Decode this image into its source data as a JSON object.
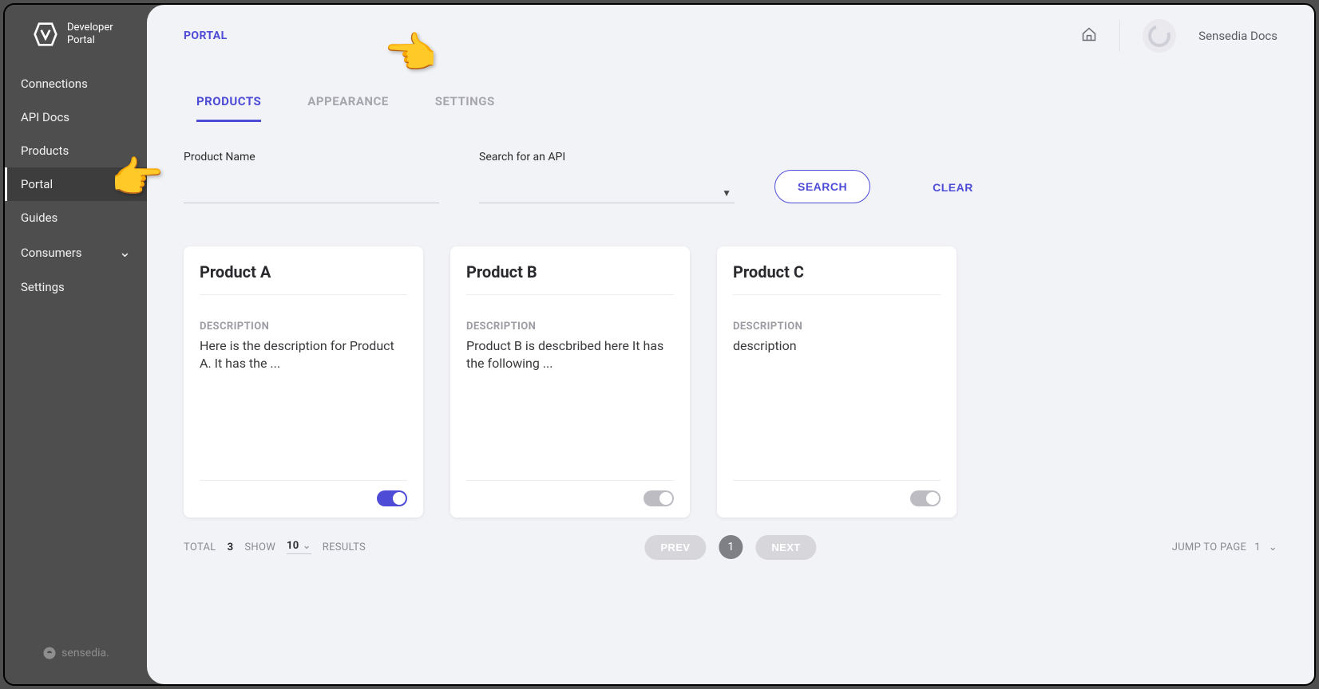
{
  "sidebar": {
    "logo_line1": "Developer",
    "logo_line2": "Portal",
    "items": [
      {
        "label": "Connections"
      },
      {
        "label": "API Docs"
      },
      {
        "label": "Products"
      },
      {
        "label": "Portal",
        "active": true
      },
      {
        "label": "Guides"
      },
      {
        "label": "Consumers",
        "expandable": true
      },
      {
        "label": "Settings"
      }
    ],
    "footer": "sensedia."
  },
  "header": {
    "breadcrumb": "PORTAL",
    "user": "Sensedia Docs"
  },
  "tabs": {
    "products": "PRODUCTS",
    "appearance": "APPEARANCE",
    "settings": "SETTINGS"
  },
  "filters": {
    "product_name_label": "Product Name",
    "api_label": "Search for an API",
    "search_btn": "SEARCH",
    "clear_btn": "CLEAR"
  },
  "cards": [
    {
      "title": "Product A",
      "desc_label": "DESCRIPTION",
      "desc": "Here is the description for Product A. It has the ...",
      "on": true
    },
    {
      "title": "Product B",
      "desc_label": "DESCRIPTION",
      "desc": "Product B is descbribed here It has the following ...",
      "on": false
    },
    {
      "title": "Product C",
      "desc_label": "DESCRIPTION",
      "desc": "description",
      "on": false
    }
  ],
  "pagination": {
    "total_label": "TOTAL",
    "total": "3",
    "show_label": "SHOW",
    "show_value": "10",
    "results_label": "RESULTS",
    "prev": "PREV",
    "current": "1",
    "next": "NEXT",
    "jump_label": "JUMP TO PAGE",
    "jump_value": "1"
  }
}
